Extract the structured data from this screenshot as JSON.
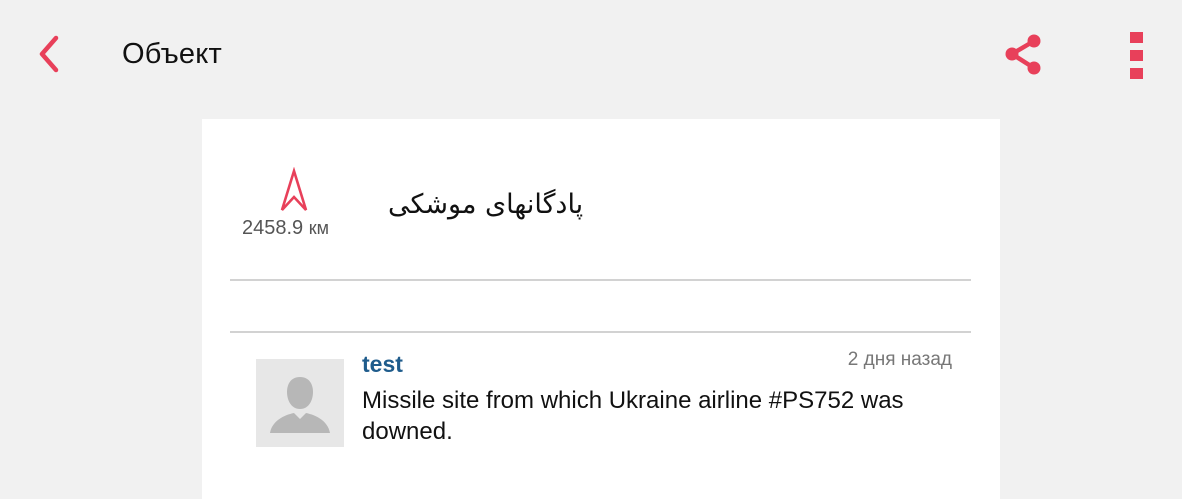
{
  "header": {
    "title": "Объект",
    "back_icon": "chevron-left-icon",
    "share_icon": "share-icon",
    "menu_icon": "more-vertical-icon",
    "accent_color": "#e8405a"
  },
  "place": {
    "name": "پادگانهای موشکی",
    "distance_value": "2458.9",
    "distance_unit": "км",
    "bearing_icon": "navigation-arrow-icon"
  },
  "comments": [
    {
      "author": "test",
      "time": "2 дня назад",
      "text": "Missile site from which Ukraine airline #PS752 was downed.",
      "avatar_icon": "user-silhouette-icon"
    }
  ]
}
